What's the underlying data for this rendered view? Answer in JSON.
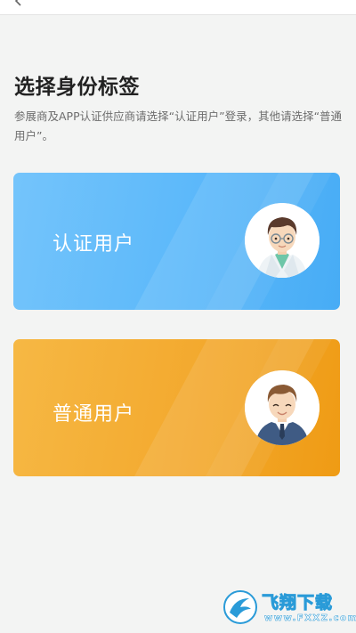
{
  "header": {
    "back_icon": "chevron-left-icon"
  },
  "page": {
    "title": "选择身份标签",
    "description": "参展商及APP认证供应商请选择“认证用户”登录，其他请选择“普通用户”。"
  },
  "options": [
    {
      "label": "认证用户",
      "avatar_icon": "doctor-avatar-icon",
      "color_start": "#74c4fb",
      "color_end": "#47acf5"
    },
    {
      "label": "普通用户",
      "avatar_icon": "businessman-avatar-icon",
      "color_start": "#f6b844",
      "color_end": "#ef9b14"
    }
  ],
  "watermark": {
    "title": "飞翔下载",
    "url": "www.FXXZ.com"
  },
  "colors": {
    "background": "#f3f4f3",
    "title_text": "#222222",
    "desc_text": "#6d6d6d",
    "card_text": "#ffffff"
  }
}
